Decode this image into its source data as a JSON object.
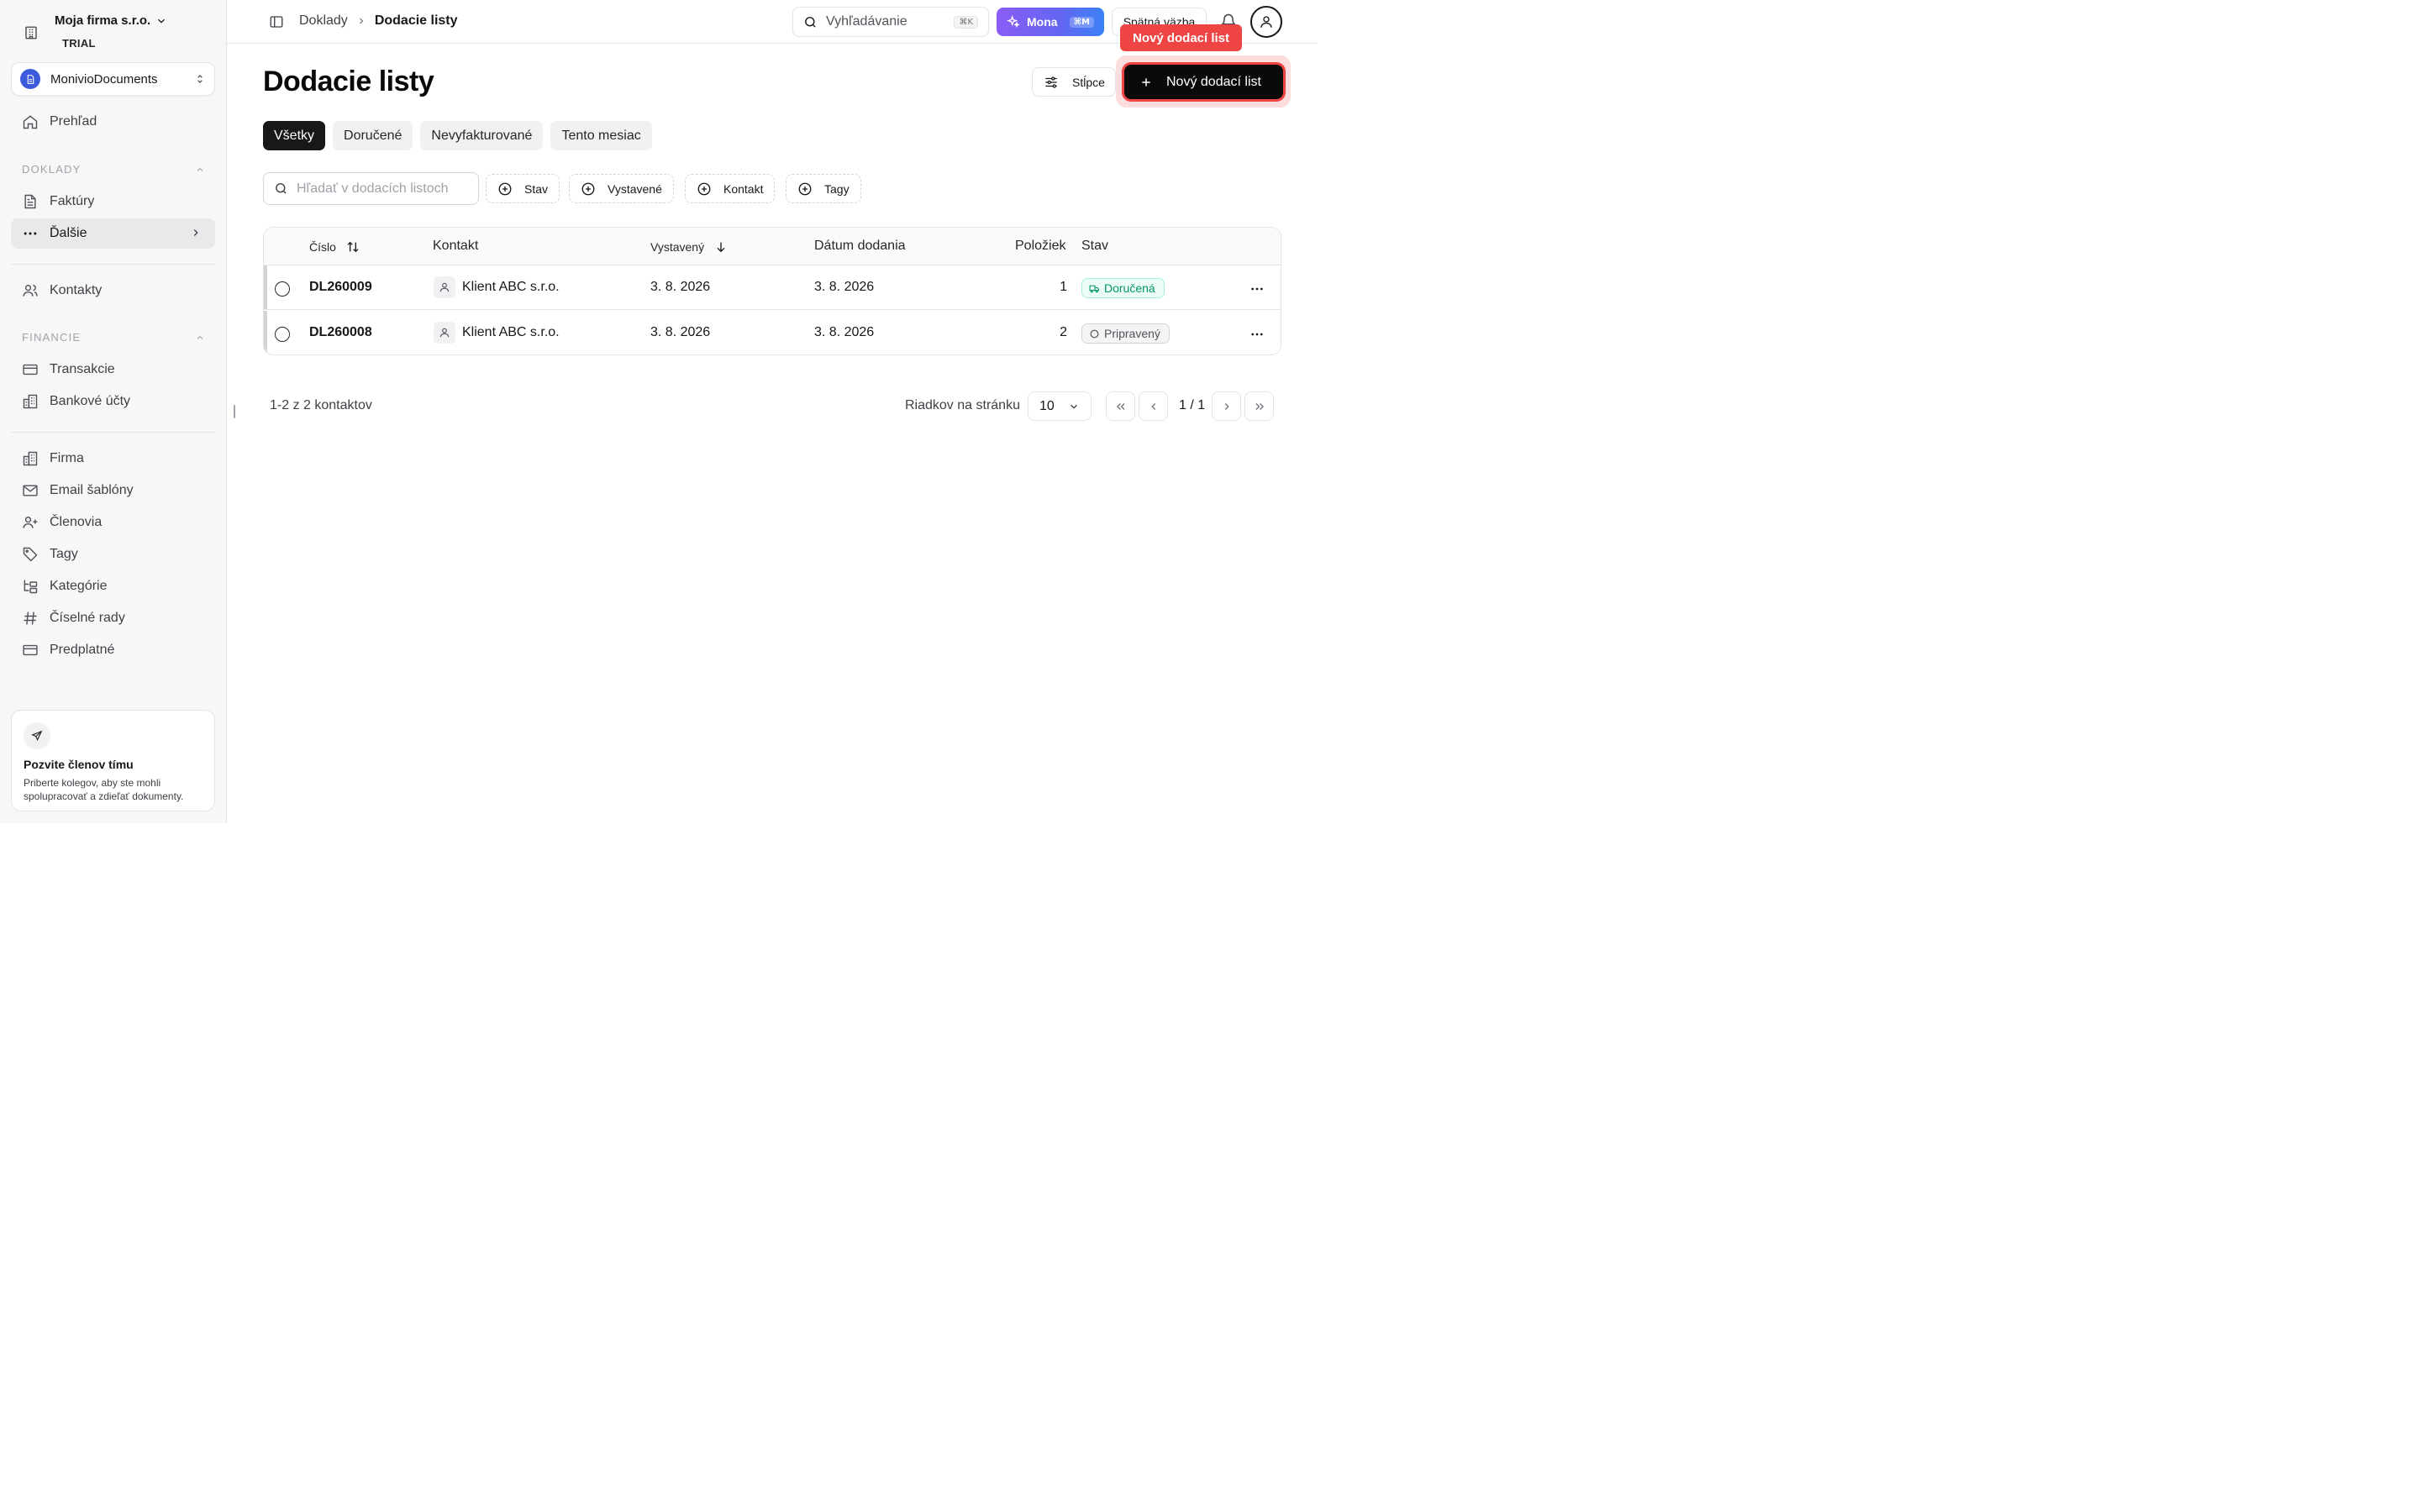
{
  "sidebar": {
    "company_name": "Moja firma s.r.o.",
    "plan": "TRIAL",
    "workspace": "MonivioDocuments",
    "overview": "Prehľad",
    "section_doklady": "DOKLADY",
    "invoices": "Faktúry",
    "more": "Ďalšie",
    "contacts": "Kontakty",
    "section_finance": "FINANCIE",
    "transactions": "Transakcie",
    "bank_accounts": "Bankové účty",
    "company": "Firma",
    "email_templates": "Email šablóny",
    "members": "Členovia",
    "tags": "Tagy",
    "categories": "Kategórie",
    "number_series": "Číselné rady",
    "subscription": "Predplatné",
    "invite_title": "Pozvite členov tímu",
    "invite_desc": "Priberte kolegov, aby ste mohli spolupracovať a zdieľať dokumenty."
  },
  "topbar": {
    "breadcrumb_parent": "Doklady",
    "breadcrumb_current": "Dodacie listy",
    "search_label": "Vyhľadávanie",
    "search_shortcut": "⌘K",
    "mona_label": "Mona",
    "mona_shortcut": "⌘M",
    "feedback_label": "Spätná väzba"
  },
  "page": {
    "title": "Dodacie listy",
    "columns_button": "Stĺpce",
    "new_button": "Nový dodací list",
    "tooltip": "Nový dodací list"
  },
  "tabs": [
    "Všetky",
    "Doručené",
    "Nevyfakturované",
    "Tento mesiac"
  ],
  "filters": {
    "search_placeholder": "Hľadať v dodacích listoch",
    "chip_status": "Stav",
    "chip_issued": "Vystavené",
    "chip_contact": "Kontakt",
    "chip_tags": "Tagy"
  },
  "table": {
    "headers": {
      "number": "Číslo",
      "contact": "Kontakt",
      "issued": "Vystavený",
      "delivery_date": "Dátum dodania",
      "items": "Položiek",
      "status": "Stav"
    },
    "rows": [
      {
        "number": "DL260009",
        "contact": "Klient ABC s.r.o.",
        "issued": "3. 8. 2026",
        "delivery_date": "3. 8. 2026",
        "items": "1",
        "status": "Doručená"
      },
      {
        "number": "DL260008",
        "contact": "Klient ABC s.r.o.",
        "issued": "3. 8. 2026",
        "delivery_date": "3. 8. 2026",
        "items": "2",
        "status": "Pripravený"
      }
    ]
  },
  "pagination": {
    "info": "1-2 z 2 kontaktov",
    "rows_label": "Riadkov na stránku",
    "rows_value": "10",
    "page_indicator": "1 / 1"
  },
  "colors": {
    "accent_highlight": "#ef4444",
    "status_delivered": "#059669",
    "mona_gradient_start": "#8b5cf6",
    "mona_gradient_end": "#3b82f6"
  }
}
